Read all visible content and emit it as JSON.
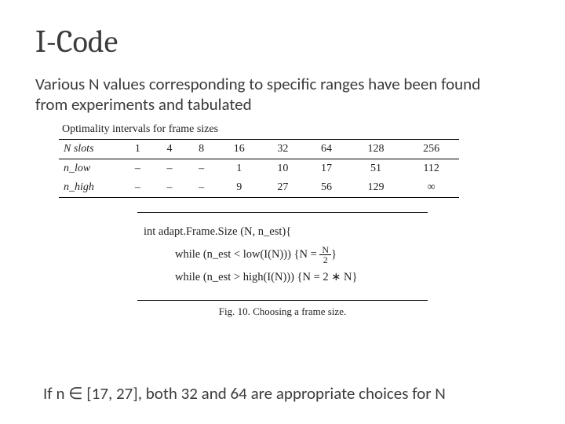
{
  "title": "I-Code",
  "intro": "Various N values corresponding to specific ranges have been found from experiments and tabulated",
  "table": {
    "caption": "Optimality intervals for frame sizes",
    "header": "N slots",
    "cols": [
      "1",
      "4",
      "8",
      "16",
      "32",
      "64",
      "128",
      "256"
    ],
    "rows": [
      {
        "label": "n_low",
        "vals": [
          "–",
          "–",
          "–",
          "1",
          "10",
          "17",
          "51",
          "112"
        ]
      },
      {
        "label": "n_high",
        "vals": [
          "–",
          "–",
          "–",
          "9",
          "27",
          "56",
          "129",
          "∞"
        ]
      }
    ]
  },
  "algo": {
    "sig_pre": "int adapt",
    "sig_mid": "Frame",
    "sig_post": "Size (N, n_est){",
    "line2_a": "while (n_est < low(I(N))) {N = ",
    "line2_frac_top": "N",
    "line2_frac_bot": "2",
    "line2_b": "}",
    "line3": "while (n_est > high(I(N))) {N = 2 ∗ N}"
  },
  "fig_caption": "Fig. 10.   Choosing a frame size.",
  "bottom_note_pre": "If n ",
  "bottom_note_sym": "∈",
  "bottom_note_post": " [17, 27], both 32 and 64 are appropriate choices for N"
}
